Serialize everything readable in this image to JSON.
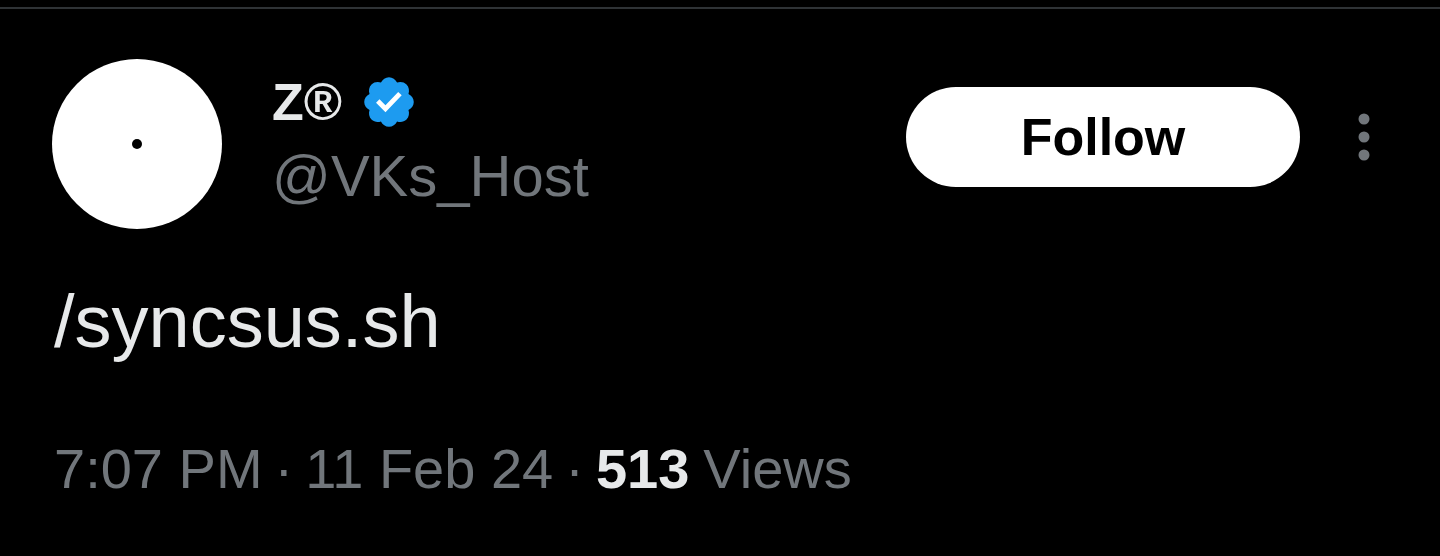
{
  "author": {
    "name": "Z®",
    "verified": true,
    "handle": "@VKs_Host"
  },
  "follow_button": {
    "label": "Follow"
  },
  "tweet": {
    "text": "/syncsus.sh"
  },
  "footer": {
    "time": "7:07 PM",
    "separators": [
      "·",
      "·"
    ],
    "date": "11 Feb 24",
    "views": {
      "count": "513",
      "label": "Views"
    }
  }
}
